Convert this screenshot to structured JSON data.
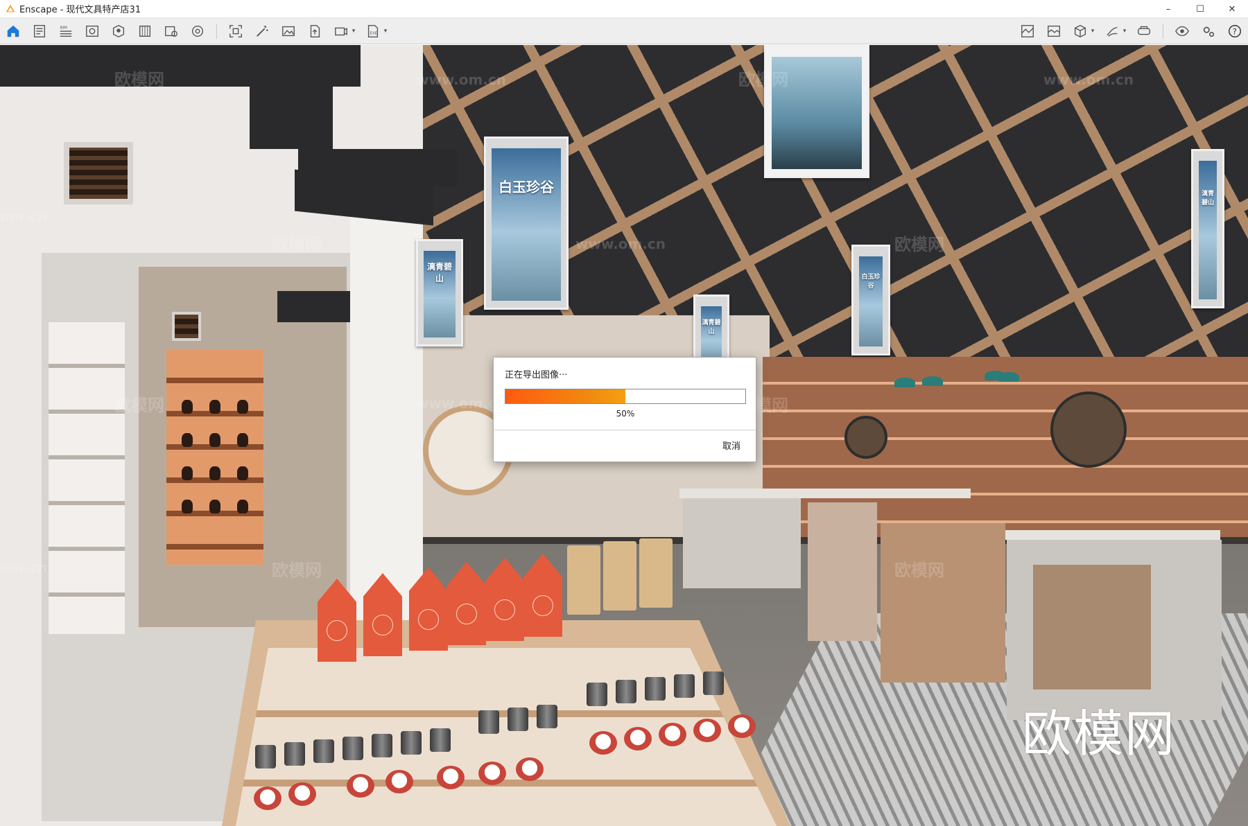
{
  "window": {
    "title": "Enscape - 现代文具特产店31",
    "controls": {
      "minimize": "–",
      "maximize": "☐",
      "close": "✕"
    }
  },
  "toolbar": {
    "left_buttons": [
      {
        "name": "home",
        "icon": "home-icon"
      },
      {
        "name": "project-info",
        "icon": "document-icon"
      },
      {
        "name": "bim",
        "icon": "bim-icon"
      },
      {
        "name": "views",
        "icon": "view-icon"
      },
      {
        "name": "assets",
        "icon": "asset-library-icon"
      },
      {
        "name": "materials",
        "icon": "material-book-icon"
      },
      {
        "name": "batch-render",
        "icon": "batch-render-icon"
      },
      {
        "name": "capture",
        "icon": "capture-icon"
      },
      {
        "name": "screenshot",
        "icon": "screenshot-icon"
      },
      {
        "name": "magic-wand",
        "icon": "magic-wand-icon"
      },
      {
        "name": "render-image",
        "icon": "image-icon"
      },
      {
        "name": "upload",
        "icon": "upload-icon"
      },
      {
        "name": "video",
        "icon": "video-icon"
      },
      {
        "name": "export",
        "icon": "export-icon"
      }
    ],
    "right_buttons": [
      {
        "name": "map-view",
        "icon": "map-icon"
      },
      {
        "name": "panorama",
        "icon": "panorama-icon"
      },
      {
        "name": "cube",
        "icon": "cube-icon"
      },
      {
        "name": "sketch",
        "icon": "sketch-icon"
      },
      {
        "name": "vr-headset",
        "icon": "vr-headset-icon"
      },
      {
        "name": "visibility",
        "icon": "eye-icon"
      },
      {
        "name": "settings",
        "icon": "gear-icon"
      },
      {
        "name": "help",
        "icon": "help-icon"
      }
    ]
  },
  "scene": {
    "banners": [
      "白玉珍谷",
      "漓青碧山",
      "漓青碧山",
      "白玉珍谷",
      "漓青碧山"
    ],
    "watermarks": [
      "欧模网",
      "www.om.cn",
      "欧模网",
      "www.om.cn",
      "om.cn",
      "欧模网",
      "www.om.cn",
      "欧模网",
      "www.om.cn",
      "欧模网",
      "欧模网",
      "om.cn",
      "欧模网",
      "欧模网"
    ],
    "logo": "欧模网"
  },
  "export_dialog": {
    "title": "正在导出图像···",
    "progress": 0.5,
    "progress_text": "50%",
    "cancel_label": "取消"
  },
  "colors": {
    "accent": "#1e78d7",
    "progress_start": "#ff5a10",
    "progress_end": "#f59f10"
  }
}
